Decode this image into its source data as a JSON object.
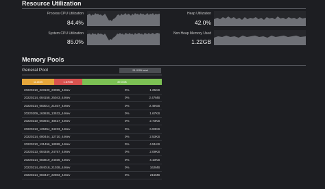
{
  "resource": {
    "title": "Resource Utilization",
    "process_cpu": {
      "label": "Process CPU Utilization",
      "value": "84.4%"
    },
    "heap": {
      "label": "Heap Utilization",
      "value": "42.0%"
    },
    "system_cpu": {
      "label": "System CPU Utilization",
      "value": "85.0%"
    },
    "non_heap": {
      "label": "Non Heap Memory Used",
      "value": "1.22GB"
    }
  },
  "memory": {
    "title": "Memory Pools",
    "pool_name": "General Pool",
    "total": "51.0GB total",
    "bar_segments": [
      {
        "label": "11.8GB",
        "fraction": 0.23,
        "color": "#e6a73b"
      },
      {
        "label": "1.67MB",
        "fraction": 0.2,
        "color": "#d9534f"
      },
      {
        "label": "39.0GB",
        "fraction": 0.57,
        "color": "#7cc154"
      }
    ],
    "rows": [
      {
        "name": "20220210_223100_23055_446ev",
        "pct": "0%",
        "size": "1.25KB"
      },
      {
        "name": "20220214_084158_25043_446ev",
        "pct": "0%",
        "size": "2.47MB"
      },
      {
        "name": "20220214_083014_21037_446ev",
        "pct": "0%",
        "size": "2.49GB"
      },
      {
        "name": "20220209_163630_13532_446ev",
        "pct": "0%",
        "size": "1.67KB"
      },
      {
        "name": "20220210_093944_48617_446ev",
        "pct": "0%",
        "size": "2.73KB"
      },
      {
        "name": "20220213_125354_34233_446ev",
        "pct": "0%",
        "size": "6.93KB"
      },
      {
        "name": "20220214_080444_12710_446ev",
        "pct": "0%",
        "size": "2.53KB"
      },
      {
        "name": "20220210_131456_18999_446ev",
        "pct": "0%",
        "size": "4.51KB"
      },
      {
        "name": "20220213_084346_24757_446ev",
        "pct": "0%",
        "size": "2.09KB"
      },
      {
        "name": "20220214_083819_24036_446ev",
        "pct": "0%",
        "size": "4.10KB"
      },
      {
        "name": "20220214_084018_21038_446ev",
        "pct": "0%",
        "size": "162MB"
      },
      {
        "name": "20220214_083447_22803_446ev",
        "pct": "0%",
        "size": "215MB"
      }
    ]
  }
}
